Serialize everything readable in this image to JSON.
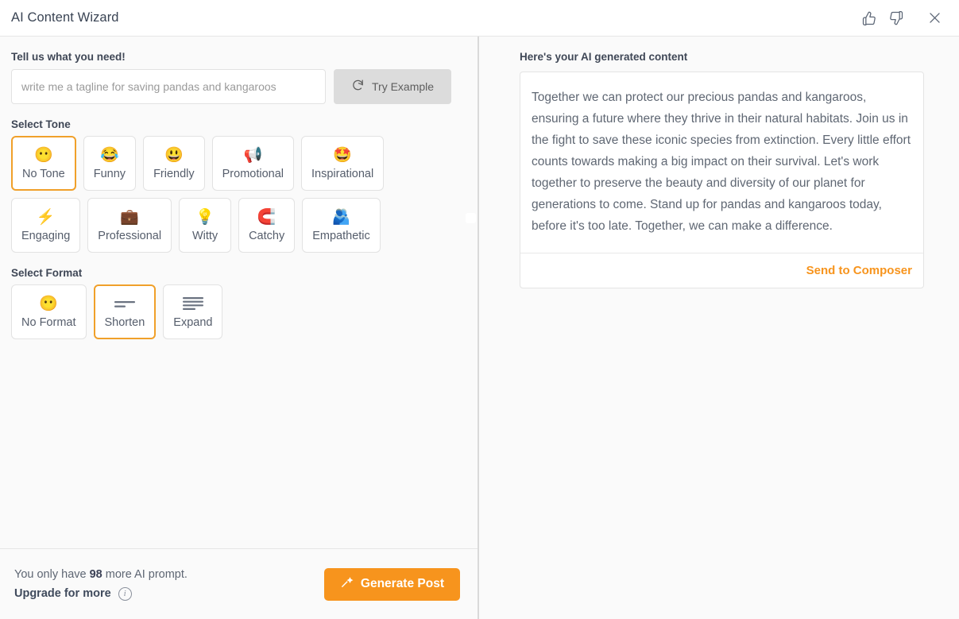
{
  "header": {
    "title": "AI Content Wizard",
    "thumbs_up_icon": "thumbs-up-icon",
    "thumbs_down_icon": "thumbs-down-icon",
    "close_icon": "close-icon"
  },
  "prompt": {
    "label": "Tell us what you need!",
    "placeholder": "write me a tagline for saving pandas and kangaroos",
    "value": "",
    "try_example_label": "Try Example",
    "try_example_icon": "refresh-icon"
  },
  "tone": {
    "label": "Select Tone",
    "options": [
      {
        "label": "No Tone",
        "emoji": "😶",
        "selected": true
      },
      {
        "label": "Funny",
        "emoji": "😂",
        "selected": false
      },
      {
        "label": "Friendly",
        "emoji": "😃",
        "selected": false
      },
      {
        "label": "Promotional",
        "emoji": "📢",
        "selected": false
      },
      {
        "label": "Inspirational",
        "emoji": "🤩",
        "selected": false
      },
      {
        "label": "Engaging",
        "emoji": "⚡",
        "selected": false
      },
      {
        "label": "Professional",
        "emoji": "💼",
        "selected": false
      },
      {
        "label": "Witty",
        "emoji": "💡",
        "selected": false
      },
      {
        "label": "Catchy",
        "emoji": "🧲",
        "selected": false
      },
      {
        "label": "Empathetic",
        "emoji": "🫂",
        "selected": false
      }
    ]
  },
  "format": {
    "label": "Select Format",
    "options": [
      {
        "label": "No Format",
        "icon": "neutral-face-emoji",
        "emoji": "😶",
        "selected": false
      },
      {
        "label": "Shorten",
        "icon": "shorten-lines-icon",
        "emoji": "",
        "selected": true
      },
      {
        "label": "Expand",
        "icon": "expand-lines-icon",
        "emoji": "",
        "selected": false
      }
    ]
  },
  "footer": {
    "quota_prefix": "You only have ",
    "quota_count": "98",
    "quota_suffix": " more AI prompt.",
    "upgrade_label": "Upgrade for more",
    "info_icon": "info-icon",
    "generate_label": "Generate Post",
    "generate_icon": "magic-wand-icon"
  },
  "result": {
    "title": "Here's your AI generated content",
    "text": "Together we can protect our precious pandas and kangaroos, ensuring a future where they thrive in their natural habitats. Join us in the fight to save these iconic species from extinction. Every little effort counts towards making a big impact on their survival. Let's work together to preserve the beauty and diversity of our planet for generations to come. Stand up for pandas and kangaroos today, before it's too late. Together, we can make a difference.",
    "send_label": "Send to Composer"
  },
  "colors": {
    "accent_orange": "#f7941d",
    "selected_border": "#f0a02a",
    "page_bg": "#fafafa",
    "card_bg": "#ffffff",
    "border": "#e2e2e2",
    "text": "#3c4257",
    "muted_text": "#5f6773"
  }
}
